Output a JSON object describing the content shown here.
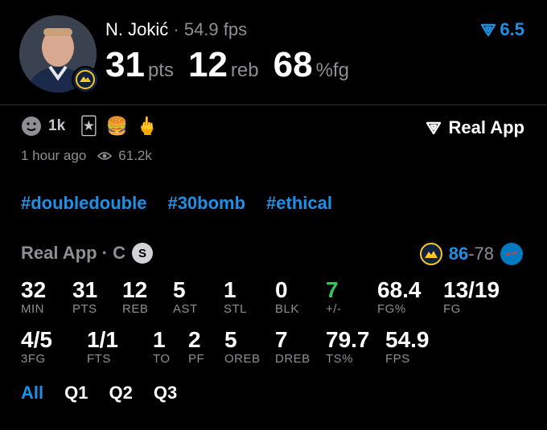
{
  "player": {
    "name": "N. Jokić",
    "separator": "·",
    "fps": "54.9 fps",
    "rating": "6.5",
    "big_stats": [
      {
        "value": "31",
        "unit": "pts"
      },
      {
        "value": "12",
        "unit": "reb"
      },
      {
        "value": "68",
        "unit": "%fg"
      }
    ]
  },
  "reactions": {
    "count": "1k",
    "emojis": [
      "🃏",
      "🍔",
      "🖕"
    ],
    "link_label": "Real App"
  },
  "meta": {
    "time": "1 hour ago",
    "views": "61.2k"
  },
  "tags": [
    "#doubledouble",
    "#30bomb",
    "#ethical"
  ],
  "game": {
    "source": "Real App · C",
    "badge": "S",
    "home_score": "86",
    "dash": "-",
    "away_score": "78",
    "colors": {
      "accent": "#1e90e6",
      "positive": "#30c85a",
      "muted": "#8e8e93"
    }
  },
  "stats_row1": [
    {
      "value": "32",
      "label": "MIN"
    },
    {
      "value": "31",
      "label": "PTS"
    },
    {
      "value": "12",
      "label": "REB"
    },
    {
      "value": "5",
      "label": "AST"
    },
    {
      "value": "1",
      "label": "STL"
    },
    {
      "value": "0",
      "label": "BLK"
    },
    {
      "value": "7",
      "label": "+/-"
    },
    {
      "value": "68.4",
      "label": "FG%"
    },
    {
      "value": "13/19",
      "label": "FG"
    }
  ],
  "stats_row2": [
    {
      "value": "4/5",
      "label": "3FG"
    },
    {
      "value": "1/1",
      "label": "FTS"
    },
    {
      "value": "1",
      "label": "TO"
    },
    {
      "value": "2",
      "label": "PF"
    },
    {
      "value": "5",
      "label": "OREB"
    },
    {
      "value": "7",
      "label": "DREB"
    },
    {
      "value": "79.7",
      "label": "TS%"
    },
    {
      "value": "54.9",
      "label": "FPS"
    }
  ],
  "periods": [
    "All",
    "Q1",
    "Q2",
    "Q3"
  ]
}
